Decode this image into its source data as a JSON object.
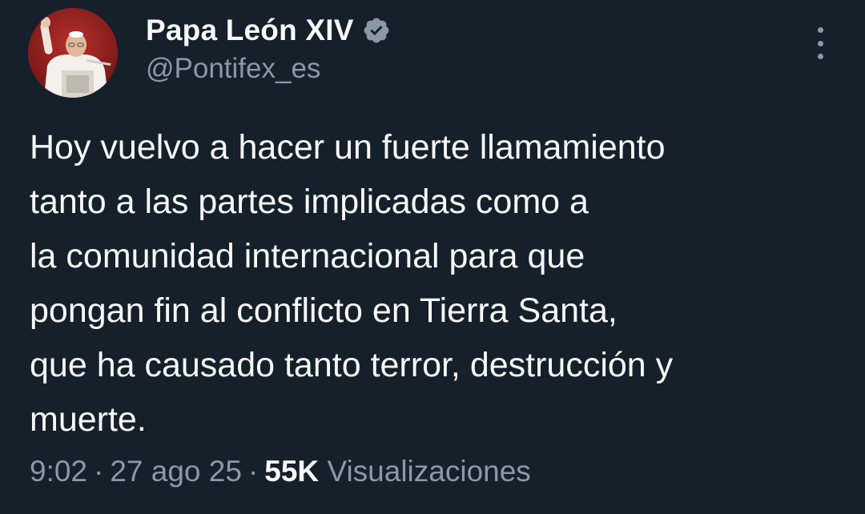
{
  "author": {
    "display_name": "Papa León XIV",
    "handle": "@Pontifex_es",
    "verified": true,
    "verified_icon": "verified-badge-icon",
    "avatar_icon": "avatar-photo"
  },
  "tweet": {
    "lines": [
      "Hoy vuelvo a hacer un fuerte llamamiento",
      "tanto a las partes implicadas como a",
      "la comunidad internacional para que",
      "pongan fin al conflicto en Tierra Santa,",
      "que ha causado tanto terror, destrucción y",
      "muerte."
    ]
  },
  "meta": {
    "time": "9:02",
    "separator": "·",
    "date": "27 ago 25",
    "views_count": "55K",
    "views_label": "Visualizaciones"
  },
  "menu": {
    "icon": "more-options-icon"
  },
  "colors": {
    "background": "#15202b",
    "primary_text": "#f7f9f9",
    "secondary_text": "#8b98a5",
    "verified_badge": "#8b98a5"
  }
}
